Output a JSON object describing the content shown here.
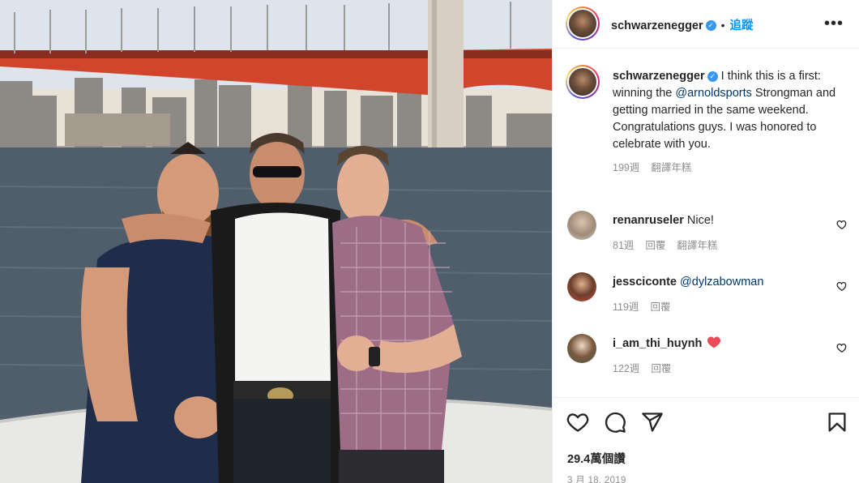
{
  "post": {
    "author": "schwarzenegger",
    "follow_label": "追蹤",
    "more_label": "•••",
    "verified_glyph": "✓",
    "separator": "•"
  },
  "caption": {
    "author": "schwarzenegger",
    "text_before": "I think this is a first: winning the ",
    "mention": "@arnoldsports",
    "text_after": " Strongman and getting married in the same weekend. Congratulations guys. I was honored to celebrate with you.",
    "time": "199週",
    "translate": "翻譯年糕"
  },
  "comments": [
    {
      "user": "renanruseler",
      "text": "Nice!",
      "time": "81週",
      "reply": "回覆",
      "translate": "翻譯年糕"
    },
    {
      "user": "jessciconte",
      "mention": "@dylzabowman",
      "time": "119週",
      "reply": "回覆"
    },
    {
      "user": "i_am_thi_huynh",
      "emoji": "heart-emoji",
      "time": "122週",
      "reply": "回覆"
    }
  ],
  "stats": {
    "views": "29.4萬個讚",
    "date": "3 月 18, 2019"
  },
  "icons": {
    "like": "heart-icon",
    "comment": "comment-icon",
    "share": "share-icon",
    "save": "bookmark-icon"
  },
  "colors": {
    "link": "#00376b",
    "follow": "#0095f6",
    "meta": "#8e8e8e",
    "heart_red": "#ed4956"
  }
}
